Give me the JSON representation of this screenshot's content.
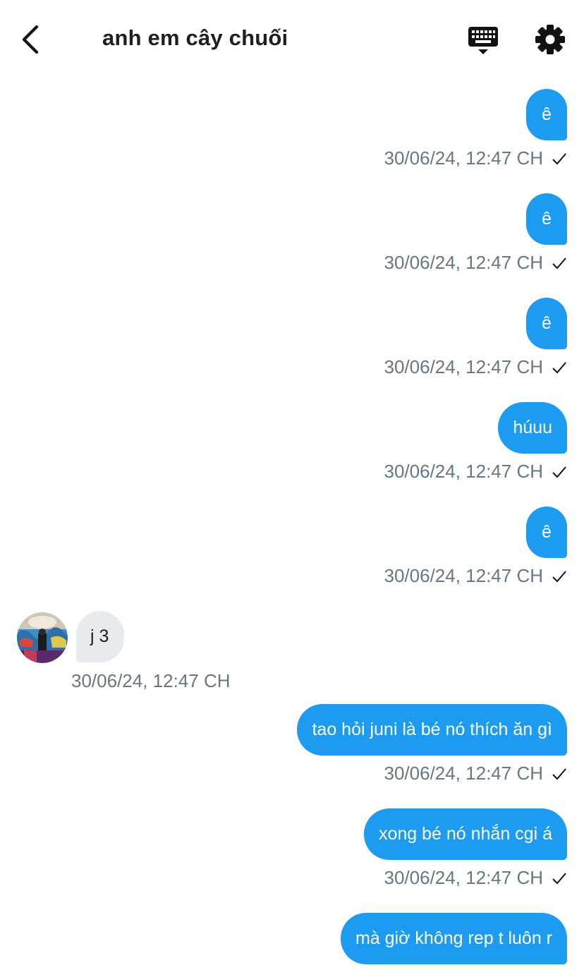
{
  "header": {
    "title": "anh em cây chuối",
    "icons": {
      "back": "chevron-left-icon",
      "keyboard": "keyboard-icon",
      "settings": "gear-icon"
    }
  },
  "colors": {
    "outgoing_bubble": "#1d9bf0",
    "incoming_bubble": "#e6ebef",
    "meta_text": "#657786"
  },
  "messages": [
    {
      "direction": "out",
      "text": "ê",
      "time": "30/06/24, 12:47 CH",
      "status": "sent"
    },
    {
      "direction": "out",
      "text": "ê",
      "time": "30/06/24, 12:47 CH",
      "status": "sent"
    },
    {
      "direction": "out",
      "text": "ê",
      "time": "30/06/24, 12:47 CH",
      "status": "sent"
    },
    {
      "direction": "out",
      "text": "húuu",
      "time": "30/06/24, 12:47 CH",
      "status": "sent"
    },
    {
      "direction": "out",
      "text": "ê",
      "time": "30/06/24, 12:47 CH",
      "status": "sent"
    },
    {
      "direction": "in",
      "text": "j 3",
      "time": "30/06/24, 12:47 CH"
    },
    {
      "direction": "out",
      "text": "tao hỏi juni là bé nó thích ăn gì",
      "time": "30/06/24, 12:47 CH",
      "status": "sent"
    },
    {
      "direction": "out",
      "text": "xong bé nó nhắn cgi á",
      "time": "30/06/24, 12:47 CH",
      "status": "sent"
    },
    {
      "direction": "out",
      "text": "mà giờ không rep t luôn r"
    }
  ]
}
